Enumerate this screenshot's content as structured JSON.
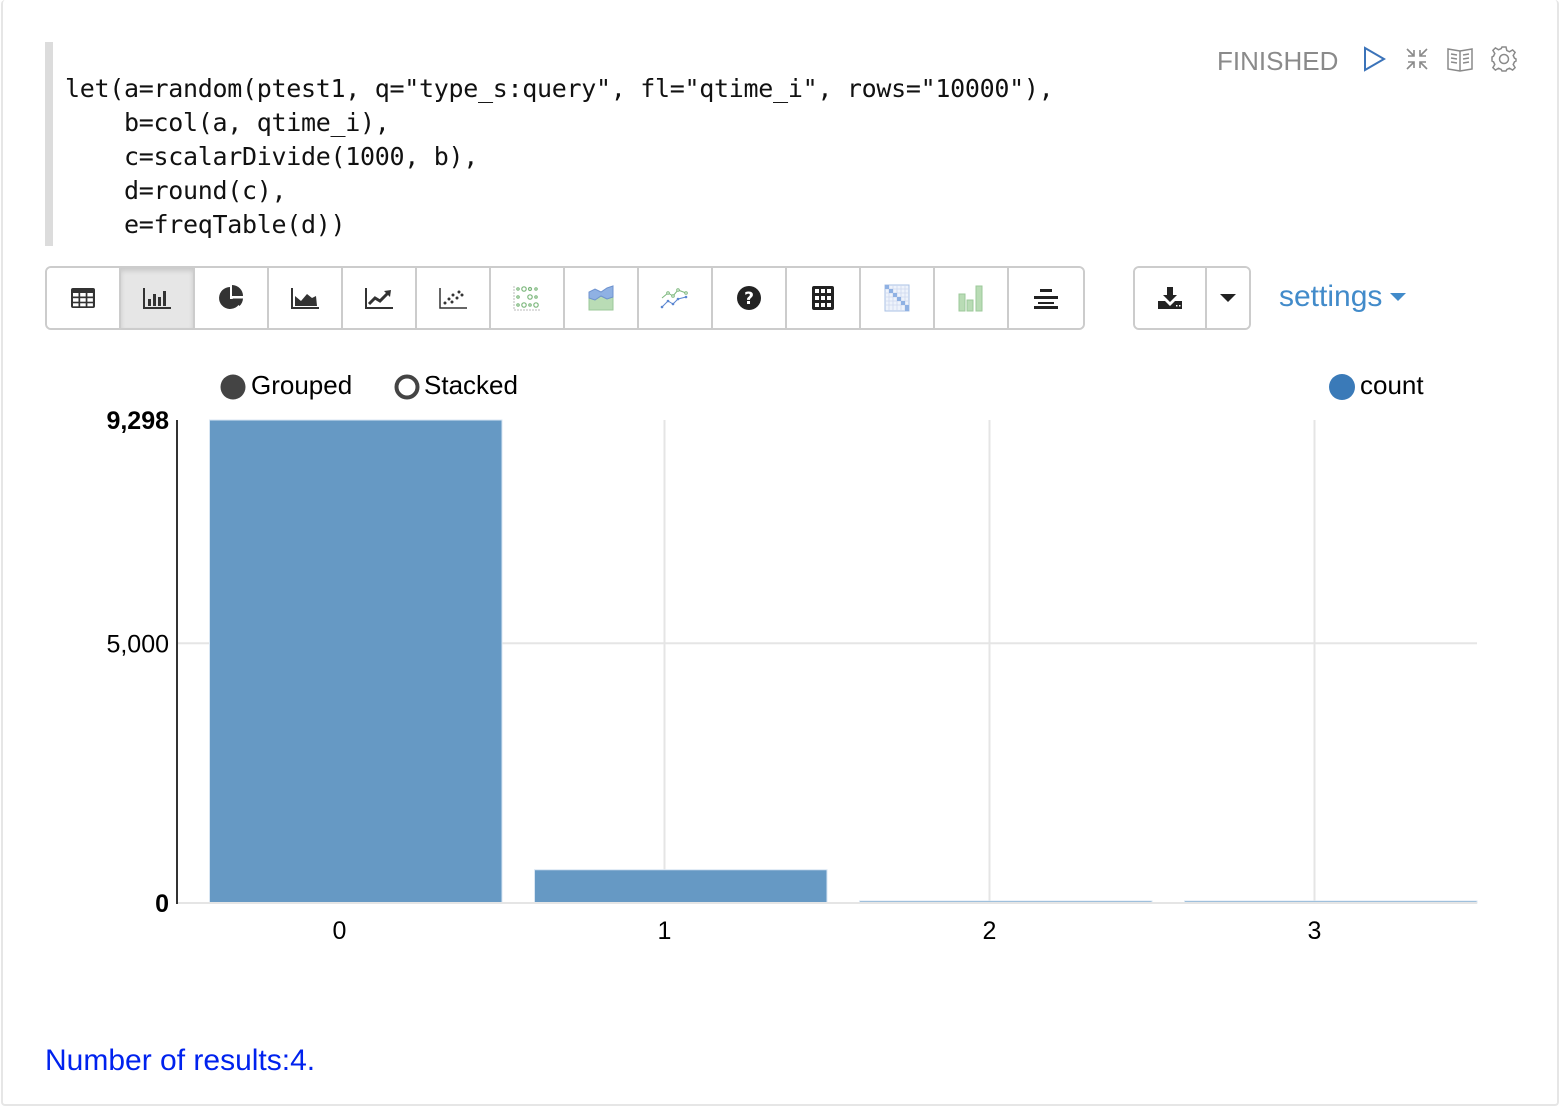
{
  "paragraph": {
    "status": "FINISHED",
    "code_lines": [
      "let(a=random(ptest1, q=\"type_s:query\", fl=\"qtime_i\", rows=\"10000\"),",
      "    b=col(a, qtime_i),",
      "    c=scalarDivide(1000, b),",
      "    d=round(c),",
      "    e=freqTable(d))"
    ],
    "header_icons": [
      "play-icon",
      "collapse-icon",
      "book-icon",
      "gear-icon"
    ]
  },
  "toolbar": {
    "buttons": [
      {
        "name": "table",
        "icon": "table-icon",
        "active": false
      },
      {
        "name": "bar-chart",
        "icon": "bar-chart-icon",
        "active": true
      },
      {
        "name": "pie-chart",
        "icon": "pie-chart-icon",
        "active": false
      },
      {
        "name": "area-chart",
        "icon": "area-chart-icon",
        "active": false
      },
      {
        "name": "line-chart",
        "icon": "line-chart-icon",
        "active": false
      },
      {
        "name": "scatter-chart",
        "icon": "scatter-chart-icon",
        "active": false
      },
      {
        "name": "bubble-chart",
        "icon": "bubble-chart-icon",
        "active": false
      },
      {
        "name": "stacked-area-chart",
        "icon": "stacked-area-icon",
        "active": false
      },
      {
        "name": "multi-line-chart",
        "icon": "multi-line-icon",
        "active": false
      },
      {
        "name": "help",
        "icon": "question-circle-icon",
        "active": false
      },
      {
        "name": "grid",
        "icon": "grid-icon",
        "active": false
      },
      {
        "name": "heatmap",
        "icon": "heatmap-icon",
        "active": false
      },
      {
        "name": "histogram",
        "icon": "histogram-icon",
        "active": false
      },
      {
        "name": "align-center",
        "icon": "align-center-icon",
        "active": false
      }
    ],
    "download_icon": "download-icon",
    "caret_icon": "caret-down-icon",
    "settings_label": "settings"
  },
  "chart_controls": {
    "grouped_label": "Grouped",
    "stacked_label": "Stacked",
    "selected": "Grouped"
  },
  "chart_data": {
    "type": "bar",
    "categories": [
      "0",
      "1",
      "2",
      "3"
    ],
    "series": [
      {
        "name": "count",
        "color": "#3a7ab8",
        "values": [
          9298,
          640,
          31,
          31
        ]
      }
    ],
    "yticks": [
      "0",
      "5,000",
      "9,298"
    ],
    "ytick_values": [
      0,
      5000,
      9298
    ],
    "ylim": [
      0,
      9298
    ],
    "xlabel": "",
    "ylabel": "",
    "grid": true,
    "legend": "top-right"
  },
  "footer": {
    "results_text": "Number of results:4."
  },
  "colors": {
    "bar_fill": "#6699c4",
    "legend_dot": "#3a7ab8",
    "link": "#428bca",
    "results": "#0022ee"
  }
}
